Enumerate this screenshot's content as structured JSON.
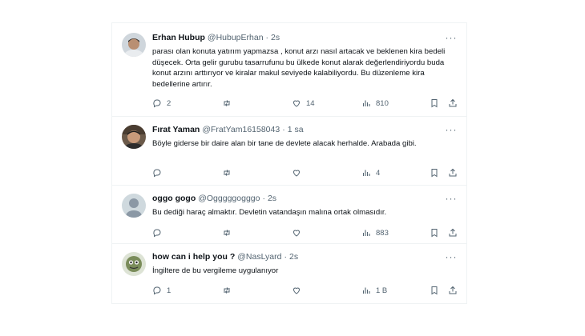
{
  "tweets": [
    {
      "name": "Erhan Hubup",
      "handle": "@HubupErhan",
      "time": "2s",
      "text": "parası olan konuta yatırım yapmazsa , konut arzı nasıl artacak ve beklenen kira bedeli düşecek. Orta gelir gurubu tasarrufunu bu ülkede konut alarak değerlendiriyordu buda konut arzını arttırıyor ve kiralar makul seviyede kalabiliyordu. Bu düzenleme kira bedellerine artırır.",
      "replies": "2",
      "retweets": "",
      "likes": "14",
      "views": "810"
    },
    {
      "name": "Fırat Yaman",
      "handle": "@FratYam16158043",
      "time": "1 sa",
      "text": "Böyle giderse bir daire alan bir tane de devlete alacak herhalde. Arabada gibi.",
      "replies": "",
      "retweets": "",
      "likes": "",
      "views": "4"
    },
    {
      "name": "oggo gogo",
      "handle": "@Ogggggogggo",
      "time": "2s",
      "text": "Bu dediği haraç almaktır. Devletin vatandaşın malına ortak olmasıdır.",
      "replies": "",
      "retweets": "",
      "likes": "",
      "views": "883"
    },
    {
      "name": "how can i help you ?",
      "handle": "@NasLyard",
      "time": "2s",
      "text": "İngiltere de bu vergileme uygulanıyor",
      "replies": "1",
      "retweets": "",
      "likes": "",
      "views": "1 B"
    }
  ],
  "icons": {
    "reply": "reply-icon",
    "retweet": "retweet-icon",
    "like": "heart-icon",
    "views": "views-icon",
    "bookmark": "bookmark-icon",
    "share": "share-icon",
    "more": "more-icon"
  },
  "colors": {
    "text": "#0f1419",
    "secondary": "#536471",
    "border": "#eff3f4"
  }
}
